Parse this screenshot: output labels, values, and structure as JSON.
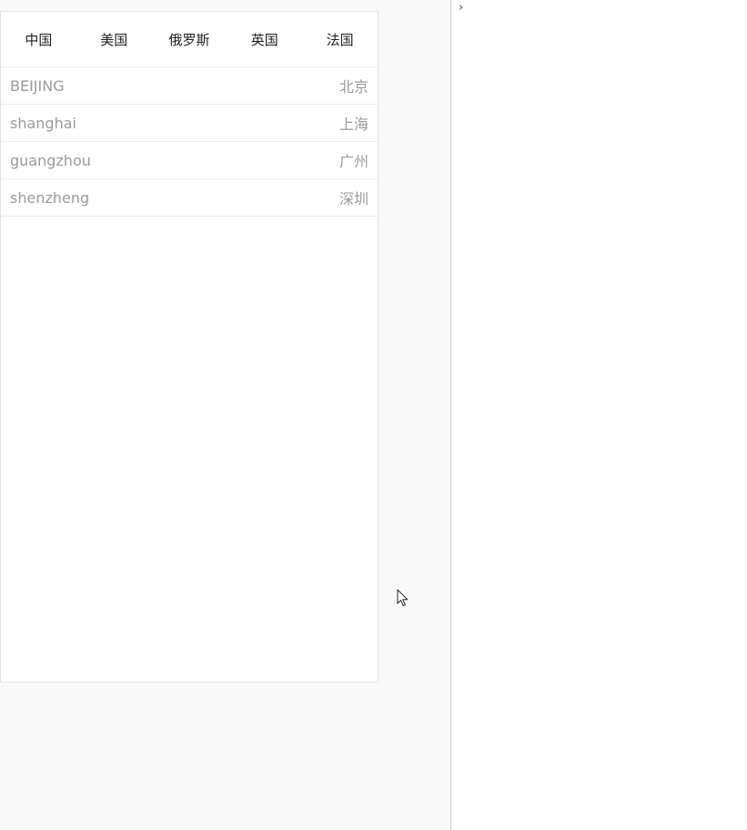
{
  "tabs": [
    {
      "label": "中国"
    },
    {
      "label": "美国"
    },
    {
      "label": "俄罗斯"
    },
    {
      "label": "英国"
    },
    {
      "label": "法国"
    }
  ],
  "cities": [
    {
      "pinyin": "BEIJING",
      "name": "北京"
    },
    {
      "pinyin": "shanghai",
      "name": "上海"
    },
    {
      "pinyin": "guangzhou",
      "name": "广州"
    },
    {
      "pinyin": "shenzheng",
      "name": "深圳"
    }
  ],
  "devtools": {
    "expand_icon": "chevron-right-icon",
    "expand_glyph": "›"
  },
  "colors": {
    "tab_text": "#222222",
    "list_text": "#9a9a9a",
    "divider": "#ececec"
  }
}
